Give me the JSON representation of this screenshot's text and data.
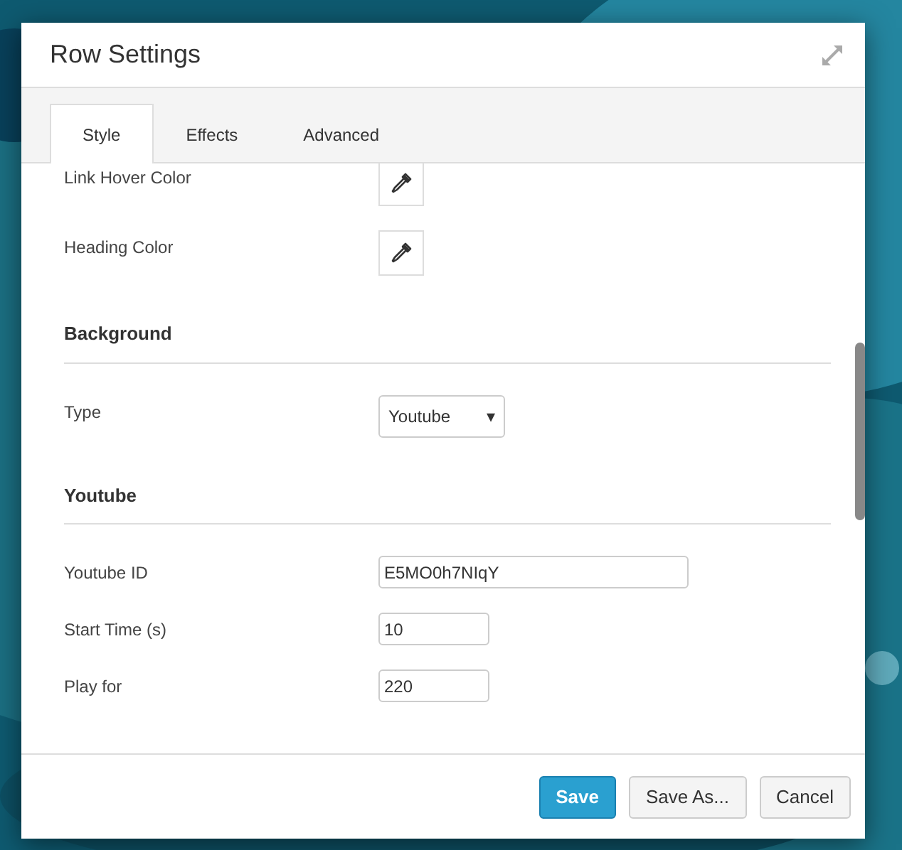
{
  "window": {
    "title": "Row Settings"
  },
  "tabs": [
    {
      "label": "Style",
      "selected": true
    },
    {
      "label": "Effects",
      "selected": false
    },
    {
      "label": "Advanced",
      "selected": false
    }
  ],
  "sections": [
    {
      "fields": [
        {
          "kind": "color",
          "label": "Link Hover Color"
        },
        {
          "kind": "color",
          "label": "Heading Color"
        }
      ]
    },
    {
      "heading": "Background",
      "fields": [
        {
          "kind": "select",
          "label": "Type",
          "value": "Youtube",
          "arrow": "▾"
        }
      ]
    },
    {
      "heading": "Youtube",
      "fields": [
        {
          "kind": "text",
          "label": "Youtube ID",
          "value": "E5MO0h7NIqY"
        },
        {
          "kind": "number",
          "label": "Start Time (s)",
          "value": "10"
        },
        {
          "kind": "number",
          "label": "Play for",
          "value": "220"
        }
      ]
    }
  ],
  "buttons": [
    {
      "label": "Save",
      "primary": true
    },
    {
      "label": "Save As...",
      "primary": false
    },
    {
      "label": "Cancel",
      "primary": false
    }
  ]
}
